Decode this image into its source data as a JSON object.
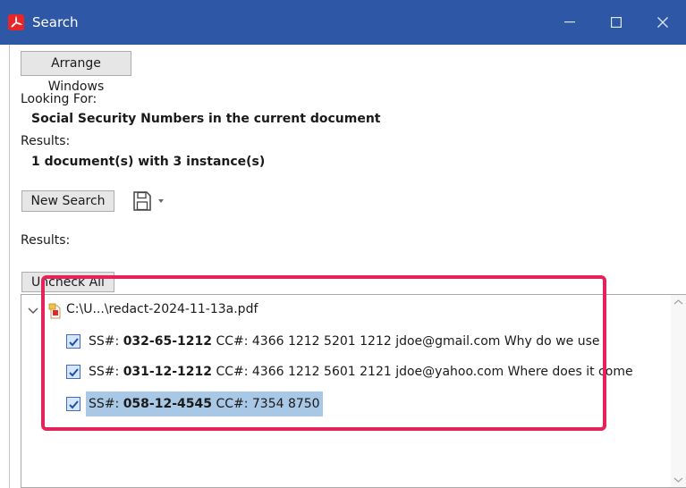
{
  "window": {
    "title": "Search"
  },
  "toolbar": {
    "arrange_label": "Arrange Windows"
  },
  "looking_for": {
    "label": "Looking For:",
    "value": "Social Security Numbers in the current document"
  },
  "results_summary": {
    "label": "Results:",
    "value": "1 document(s) with 3 instance(s)"
  },
  "actions": {
    "new_search_label": "New Search"
  },
  "results_list": {
    "label": "Results:",
    "uncheck_label": "Uncheck All",
    "file": "C:\\U...\\redact-2024-11-13a.pdf",
    "items": [
      {
        "ss_label": "SS#:",
        "ss_value": "032-65-1212",
        "rest": "CC#: 4366 1212 5201 1212 jdoe@gmail.com Why do we use",
        "checked": true
      },
      {
        "ss_label": "SS#:",
        "ss_value": "031-12-1212",
        "rest": "CC#: 4366 1212 5601 2121 jdoe@yahoo.com Where does it come",
        "checked": true
      },
      {
        "ss_label": "SS#:",
        "ss_value": "058-12-4545",
        "rest": "CC#: 7354 8750",
        "checked": true,
        "selected": true
      }
    ]
  },
  "colors": {
    "titlebar": "#2e58a6",
    "highlight": "#e6225a",
    "selection": "#a9c8e6"
  }
}
